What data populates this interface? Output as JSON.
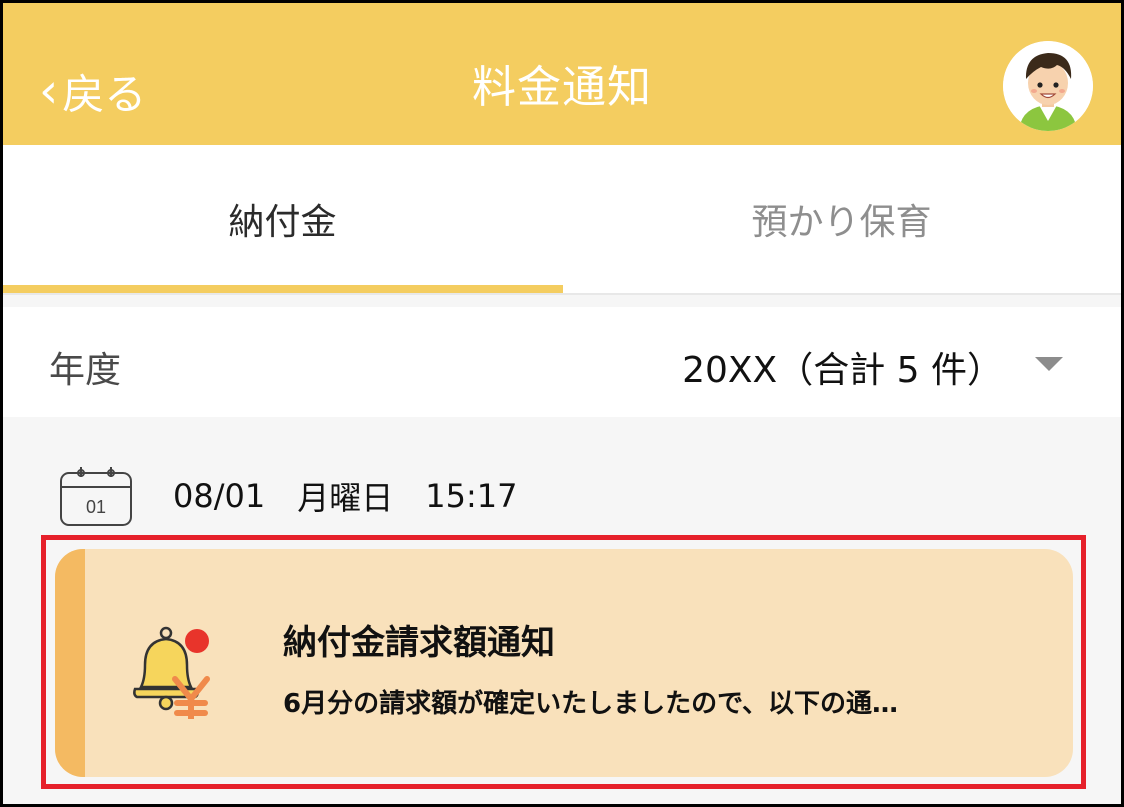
{
  "header": {
    "back_label": "戻る",
    "title": "料金通知",
    "accent_color": "#f4cd60"
  },
  "tabs": [
    {
      "label": "納付金",
      "active": true
    },
    {
      "label": "預かり保育",
      "active": false
    }
  ],
  "year_selector": {
    "label": "年度",
    "value": "20XX（合計 5 件）"
  },
  "notification": {
    "date": "08/01",
    "weekday": "月曜日",
    "time": "15:17",
    "calendar_day": "01",
    "title": "納付金請求額通知",
    "body": "6月分の請求額が確定いたしましたので、以下の通…",
    "card_color": "#f9e1bb",
    "stripe_color": "#f4ba62",
    "highlight_color": "#e6202a"
  },
  "icons": {
    "back": "chevron-left-icon",
    "avatar": "user-avatar",
    "calendar": "calendar-icon",
    "notification": "bell-yen-icon",
    "dropdown": "caret-down-icon"
  }
}
